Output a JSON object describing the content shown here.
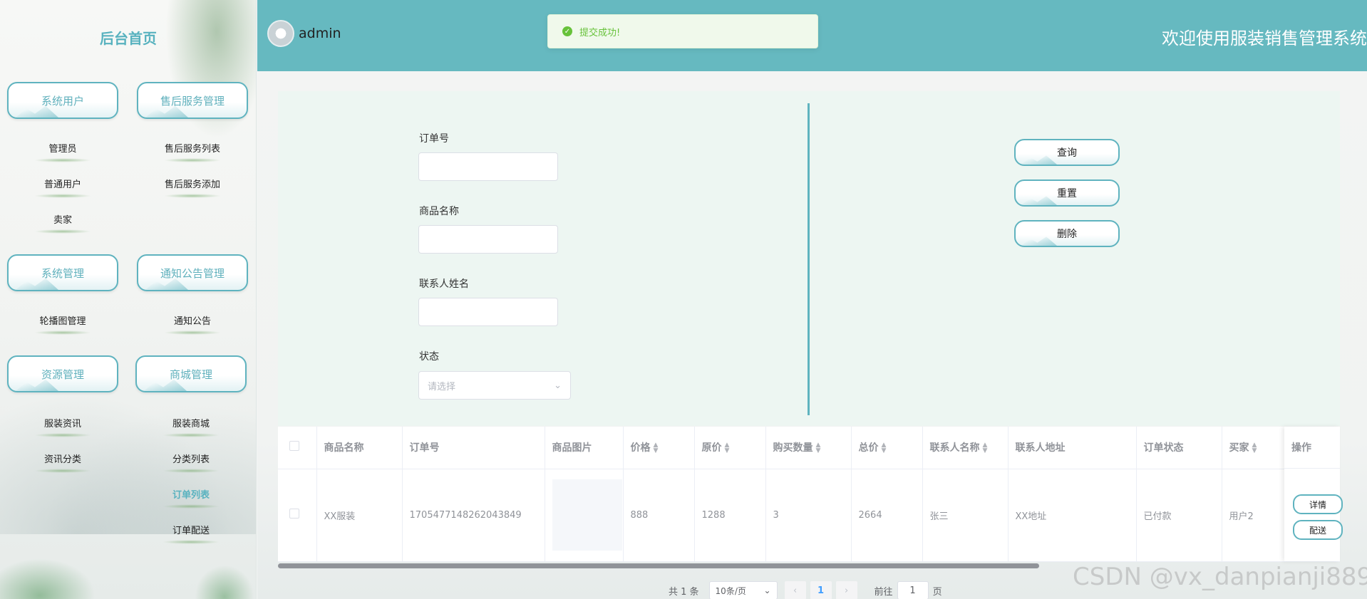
{
  "sidebar": {
    "home": "后台首页",
    "groups": [
      {
        "label": "系统用户"
      },
      {
        "label": "售后服务管理"
      },
      {
        "label": "系统管理"
      },
      {
        "label": "通知公告管理"
      },
      {
        "label": "资源管理"
      },
      {
        "label": "商城管理"
      }
    ],
    "items": [
      "管理员",
      "普通用户",
      "卖家",
      "售后服务列表",
      "售后服务添加",
      "轮播图管理",
      "通知公告",
      "服装资讯",
      "资讯分类",
      "服装商城",
      "分类列表",
      "订单列表",
      "订单配送"
    ]
  },
  "header": {
    "username": "admin",
    "welcome": "欢迎使用服装销售管理系统",
    "toast": "提交成功!"
  },
  "search": {
    "order_no_label": "订单号",
    "product_name_label": "商品名称",
    "contact_name_label": "联系人姓名",
    "status_label": "状态",
    "status_placeholder": "请选择",
    "buttons": [
      "查询",
      "重置",
      "删除"
    ]
  },
  "table": {
    "columns": [
      "商品名称",
      "订单号",
      "商品图片",
      "价格",
      "原价",
      "购买数量",
      "总价",
      "联系人名称",
      "联系人地址",
      "订单状态",
      "买家",
      "操作"
    ],
    "rows": [
      {
        "product": "XX服装",
        "order_no": "1705477148262043849",
        "price": "888",
        "original_price": "1288",
        "quantity": "3",
        "total": "2664",
        "contact_name": "张三",
        "address": "XX地址",
        "status": "已付款",
        "buyer": "用户2",
        "actions": [
          "详情",
          "配送"
        ]
      }
    ]
  },
  "pagination": {
    "total": "共 1 条",
    "page_size": "10条/页",
    "current_page": "1",
    "goto_prefix": "前往",
    "goto_value": "1",
    "goto_suffix": "页"
  },
  "watermark": "CSDN @vx_danpianji889"
}
